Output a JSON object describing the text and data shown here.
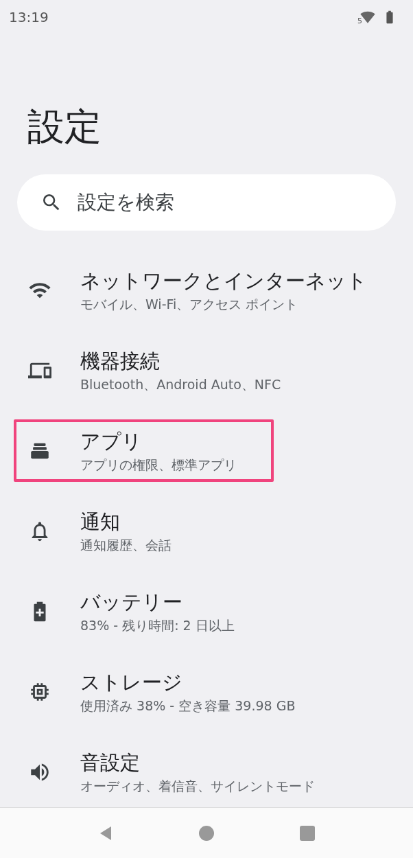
{
  "status_bar": {
    "time": "13:19",
    "signal_label": "5"
  },
  "title": "設定",
  "search": {
    "placeholder": "設定を検索"
  },
  "items": [
    {
      "kind": "wifi",
      "title": "ネットワークとインターネット",
      "subtitle": "モバイル、Wi-Fi、アクセス ポイント",
      "highlighted": false
    },
    {
      "kind": "devices",
      "title": "機器接続",
      "subtitle": "Bluetooth、Android Auto、NFC",
      "highlighted": false
    },
    {
      "kind": "apps",
      "title": "アプリ",
      "subtitle": "アプリの権限、標準アプリ",
      "highlighted": true
    },
    {
      "kind": "bell",
      "title": "通知",
      "subtitle": "通知履歴、会話",
      "highlighted": false
    },
    {
      "kind": "battery",
      "title": "バッテリー",
      "subtitle": "83% - 残り時間: 2 日以上",
      "highlighted": false
    },
    {
      "kind": "storage",
      "title": "ストレージ",
      "subtitle": "使用済み 38% - 空き容量 39.98 GB",
      "highlighted": false
    },
    {
      "kind": "sound",
      "title": "音設定",
      "subtitle": "オーディオ、着信音、サイレントモード",
      "highlighted": false
    }
  ]
}
